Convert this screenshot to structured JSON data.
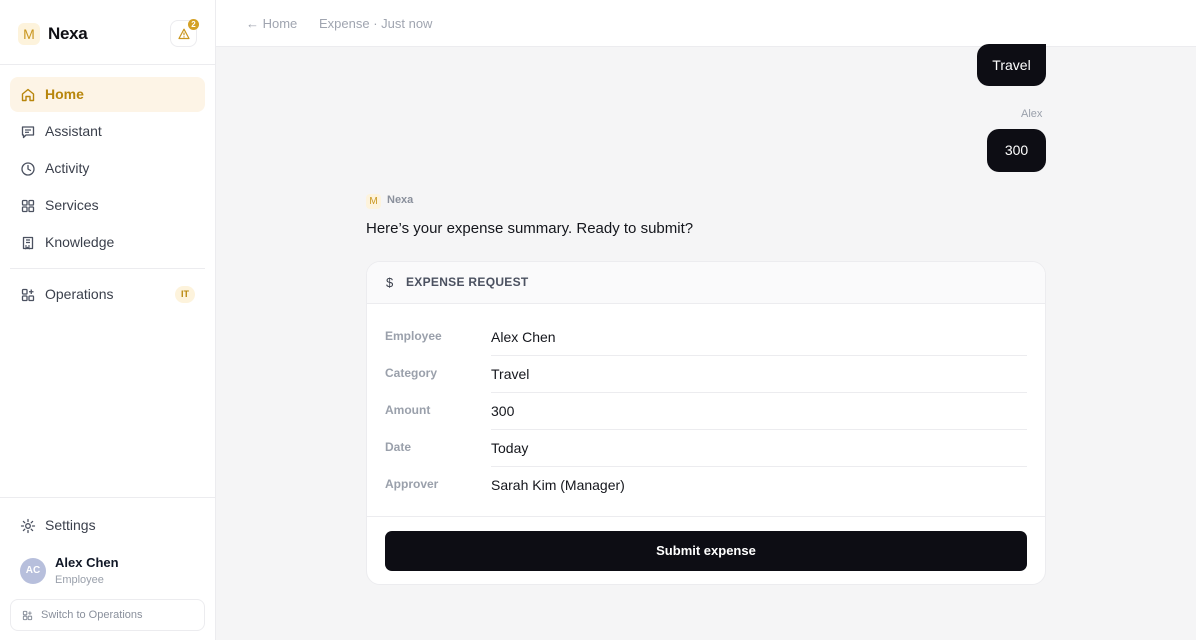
{
  "brand": {
    "logo_letter": "M",
    "name": "Nexa",
    "alert_count": "2"
  },
  "sidebar": {
    "items": [
      {
        "label": "Home",
        "icon": "home-icon",
        "active": true
      },
      {
        "label": "Assistant",
        "icon": "chat-icon"
      },
      {
        "label": "Activity",
        "icon": "clock-icon"
      },
      {
        "label": "Services",
        "icon": "grid-icon"
      },
      {
        "label": "Knowledge",
        "icon": "book-icon"
      }
    ],
    "operations": {
      "label": "Operations",
      "badge": "IT",
      "icon": "operations-icon"
    },
    "settings_label": "Settings",
    "user": {
      "initials": "AC",
      "name": "Alex Chen",
      "role": "Employee"
    },
    "switch_label": "Switch to Operations"
  },
  "topbar": {
    "back_label": "← Home",
    "breadcrumb": "Expense · Just now"
  },
  "chat": {
    "user_bubble_1": "Travel",
    "user_sender": "Alex",
    "user_bubble_2": "300",
    "assistant_logo": "M",
    "assistant_name": "Nexa",
    "assistant_message": "Here’s your expense summary. Ready to submit?"
  },
  "card": {
    "icon": "$",
    "title": "EXPENSE REQUEST",
    "fields": [
      {
        "key": "Employee",
        "value": "Alex Chen"
      },
      {
        "key": "Category",
        "value": "Travel"
      },
      {
        "key": "Amount",
        "value": "300"
      },
      {
        "key": "Date",
        "value": "Today"
      },
      {
        "key": "Approver",
        "value": "Sarah Kim (Manager)"
      }
    ],
    "submit_label": "Submit expense"
  },
  "colors": {
    "accent": "#d4a126",
    "primary_dark": "#0d0d14",
    "active_bg": "#fdf4e6"
  }
}
